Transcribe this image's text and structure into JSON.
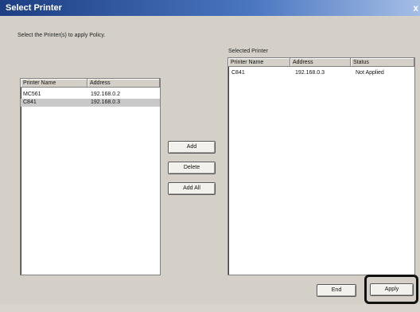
{
  "window": {
    "title": "Select Printer",
    "close_glyph": "x"
  },
  "left": {
    "instruction": "Select the Printer(s) to apply Policy.",
    "columns": [
      "Printer Name",
      "Address"
    ],
    "rows": [
      {
        "name": "MC561",
        "address": "192.168.0.2"
      },
      {
        "name": "C841",
        "address": "192.168.0.3"
      }
    ]
  },
  "middle": {
    "add_label": "Add",
    "delete_label": "Delete",
    "add_all_label": "Add All"
  },
  "right": {
    "caption": "Selected Printer",
    "columns": [
      "Printer Name",
      "Address",
      "Status"
    ],
    "rows": [
      {
        "name": "C841",
        "address": "192.168.0.3",
        "status": "Not Applied"
      }
    ]
  },
  "footer": {
    "end_label": "End",
    "apply_label": "Apply"
  }
}
